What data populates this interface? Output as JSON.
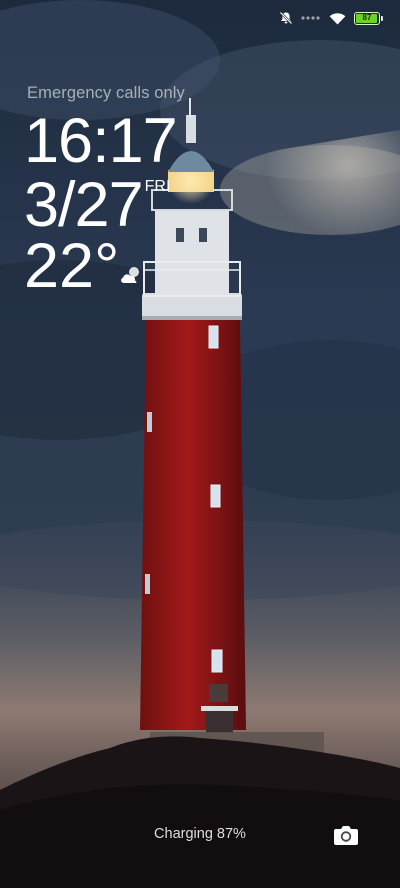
{
  "status_bar": {
    "icons": [
      "muted-bell-icon",
      "signal-dots-icon",
      "wifi-icon",
      "battery-icon"
    ],
    "battery_level": "87",
    "battery_color": "#6bd22a"
  },
  "lockscreen": {
    "carrier_text": "Emergency calls only",
    "time": "16:17",
    "date": "3/27",
    "weekday": "FRI",
    "temperature": "22°",
    "weather_icon": "partly-cloudy-icon",
    "charging_text": "Charging 87%",
    "camera_icon": "camera-icon"
  }
}
